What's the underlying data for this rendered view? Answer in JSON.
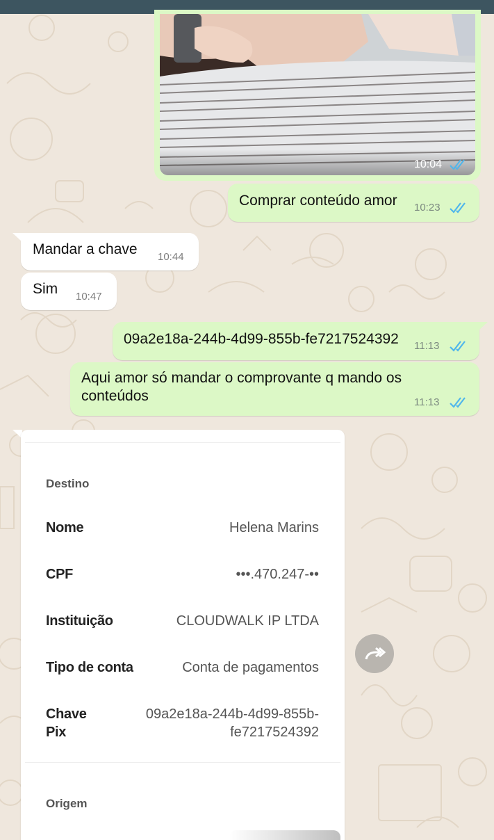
{
  "messages": {
    "photo_time": "10:04",
    "m1": {
      "text": "Comprar conteúdo amor",
      "time": "10:23"
    },
    "m2": {
      "text": "Mandar a chave",
      "time": "10:44"
    },
    "m3": {
      "text": "Sim",
      "time": "10:47"
    },
    "m4": {
      "text": "09a2e18a-244b-4d99-855b-fe7217524392",
      "time": "11:13"
    },
    "m5": {
      "text_line1": "Aqui amor só mandar o comprovante q mando os",
      "text_line2": "conteúdos",
      "time": "11:13"
    }
  },
  "receipt": {
    "section_destino": "Destino",
    "nome_label": "Nome",
    "nome_value": "Helena Marins",
    "cpf_label": "CPF",
    "cpf_value": "•••.470.247-••",
    "instituicao_label": "Instituição",
    "instituicao_value": "CLOUDWALK IP LTDA",
    "tipo_label": "Tipo de conta",
    "tipo_value": "Conta de pagamentos",
    "chave_label_line1": "Chave",
    "chave_label_line2": "Pix",
    "chave_value_line1": "09a2e18a-244b-4d99-855b-",
    "chave_value_line2": "fe7217524392",
    "section_origem": "Origem"
  },
  "colors": {
    "wallpaper": "#efe7dd",
    "outgoing_bubble": "#dcf8c6",
    "incoming_bubble": "#ffffff",
    "read_ticks": "#4fb6ec",
    "top_bar": "#3d5560"
  },
  "icons": [
    "double-check-icon",
    "forward-icon"
  ]
}
